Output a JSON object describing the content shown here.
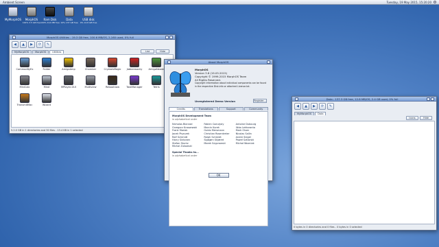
{
  "menubar": {
    "title": "Ambient Screen",
    "clock": "Tuesday, 19 May 2015, 15:20:20"
  },
  "desktop_icons": [
    {
      "label": "MyMorphOS",
      "sub": ""
    },
    {
      "label": "MorphOS",
      "sub": "100% 3.5 GB free"
    },
    {
      "label": "Ram Disk",
      "sub": "100% 414 MB free"
    },
    {
      "label": "Data",
      "sub": "10% 137 GB free"
    },
    {
      "label": "USB disk",
      "sub": "0% 14.8 GB free"
    }
  ],
  "left_window": {
    "title": "MorphOS:Utilities - 19.3 GB free, 100.6 MB/OS, 2,160 used, 0% full",
    "tabs": [
      "MyMorphOS",
      "MorphOS",
      "Utilities"
    ],
    "active_tab": 2,
    "buttons": [
      "List",
      "Hide"
    ],
    "files": [
      {
        "label": "CommodityEx",
        "color": "#6aa0d8"
      },
      {
        "label": "Folder",
        "color": "#2a7fd4"
      },
      {
        "label": "AmigaAmp",
        "color": "#f2c200"
      },
      {
        "label": "Chamber",
        "color": "#7a6a5a"
      },
      {
        "label": "CrystalsMagic",
        "color": "#d8442a"
      },
      {
        "label": "Jabberwocky",
        "color": "#d22020"
      },
      {
        "label": "AmigaNewer",
        "color": "#4c9a3a"
      },
      {
        "label": "MiniCalc",
        "color": "#88888f"
      },
      {
        "label": "Mind",
        "color": "#c0c8d4"
      },
      {
        "label": "MPlayer-GUI",
        "color": "#666a70"
      },
      {
        "label": "Multiview",
        "color": "#9aa0aa"
      },
      {
        "label": "Rebootnow",
        "color": "#3a2a1a"
      },
      {
        "label": "TaskManager",
        "color": "#7a3ad0"
      },
      {
        "label": "Tetris",
        "color": "#1a9a9a"
      },
      {
        "label": "TransmitMac",
        "color": "#c87a1a"
      },
      {
        "label": "Wizard",
        "color": "#dde2ea"
      }
    ],
    "status": "5.2.0 GB in 1 directories and 30 files - 13.4 KB in 1 selected"
  },
  "about_dialog": {
    "title": "About MorphOS",
    "name": "MorphOS",
    "version": "Version 3.8 (19.05.2015)",
    "copyright": "Copyright © 1999-2015 MorphOS Team",
    "rights": "All Rights Reserved.",
    "copyright_info_1": "Copyright information about individual components can be found",
    "copyright_info_2": "in the respective Disk.info or attached License.txt.",
    "registration": "Unregistered Demo Version",
    "register_button": "Register...",
    "tabs": [
      "Credits",
      "Translations",
      "Support",
      "Community"
    ],
    "active_tab": 0,
    "team_heading": "MorphOS Development Team",
    "team_order": "in alphabetical order",
    "team_members": [
      "Nicholas Blanrad",
      "Fabien Coeurjoly",
      "Antoine Dubourg",
      "Grzegorz Kraszewski",
      "Marcin Kurek",
      "Ilkka Lehtoranta",
      "Frank Mariak",
      "Guido Mersmann",
      "Mark Olsen",
      "Jacek Piszczek",
      "Christian Rosentreter",
      "Nicolas Sallin",
      "Ralf Schmidt",
      "Ralph Schmidt",
      "Andre Siegel",
      "Harry Sintonen",
      "Sigbjørn Skjæret",
      "Paweł Szklarski",
      "Stefan Stuntz",
      "Marek Szyprowski",
      "Michał Wozniak",
      "Michal Zukowski",
      "",
      ""
    ],
    "thanks_heading": "Special Thanks to...",
    "thanks_order": "in alphabetical order",
    "ok_button": "OK"
  },
  "right_window": {
    "title": "Data - 137.3 GB free, 12.8 MB/OS, 2.4 GB used, 0% full",
    "tabs": [
      "MyMorphOS",
      "Data"
    ],
    "active_tab": 1,
    "buttons": [
      "Icons",
      "Hide"
    ],
    "status": "0 bytes in 0 directories and 0 files - 0 bytes in 0 selected"
  },
  "colors": {
    "desktop": "#3a6fba",
    "titlebar": "#8fb0e0",
    "window_bg": "#e9edf3",
    "butterfly": "#2f8fe0"
  }
}
